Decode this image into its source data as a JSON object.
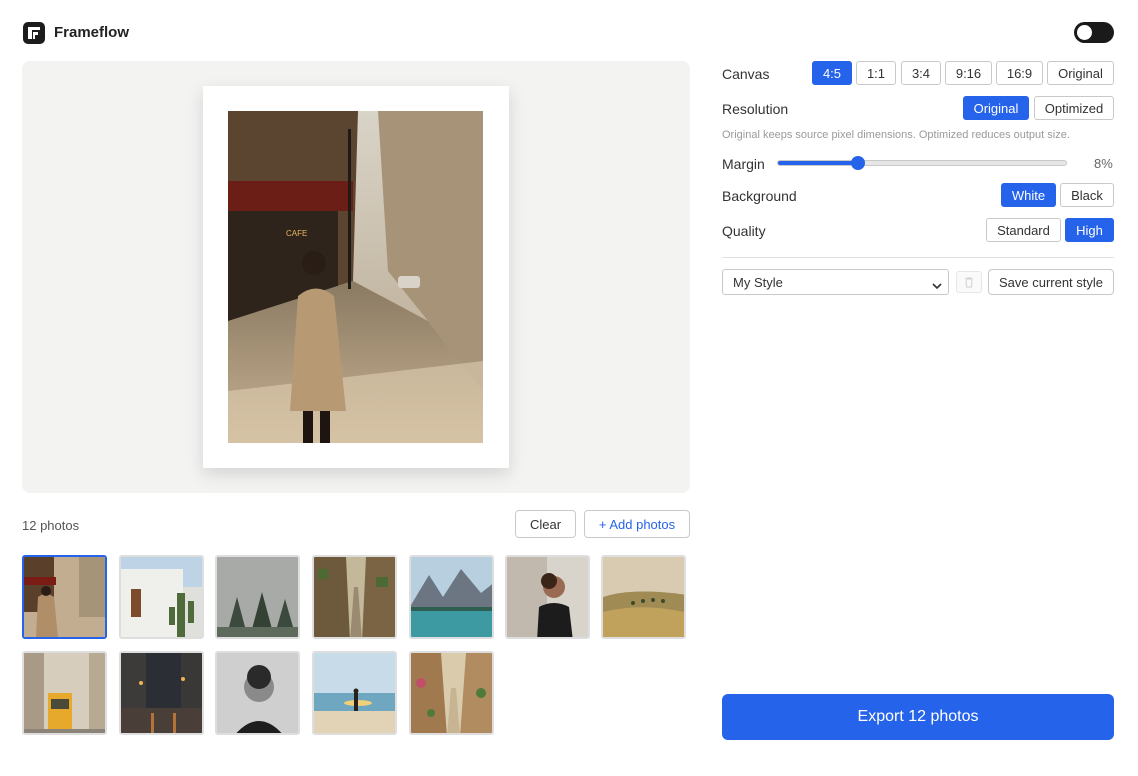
{
  "app": {
    "title": "Frameflow",
    "logo_icon": "frame-logo-icon"
  },
  "header": {
    "theme_toggle_icon": "toggle-icon"
  },
  "photos": {
    "count_label": "12 photos",
    "clear_label": "Clear",
    "add_label": "+ Add photos",
    "thumbnails": [
      {
        "subject": "paris street cafe woman in trench coat",
        "selected": true
      },
      {
        "subject": "white wall with cactus"
      },
      {
        "subject": "foggy pine forest"
      },
      {
        "subject": "narrow old town alley"
      },
      {
        "subject": "mountain lake"
      },
      {
        "subject": "woman portrait profile"
      },
      {
        "subject": "tuscany rolling hills"
      },
      {
        "subject": "yellow tram on city street"
      },
      {
        "subject": "rainy city street at dusk"
      },
      {
        "subject": "black and white man portrait"
      },
      {
        "subject": "surfer on beach"
      },
      {
        "subject": "flowered narrow lane"
      }
    ]
  },
  "settings": {
    "canvas": {
      "label": "Canvas",
      "options": [
        "4:5",
        "1:1",
        "3:4",
        "9:16",
        "16:9",
        "Original"
      ],
      "selected": "4:5"
    },
    "resolution": {
      "label": "Resolution",
      "options": [
        "Original",
        "Optimized"
      ],
      "selected": "Original",
      "hint": "Original keeps source pixel dimensions. Optimized reduces output size."
    },
    "margin": {
      "label": "Margin",
      "value": 8,
      "value_label": "8%",
      "fraction": 0.27
    },
    "background": {
      "label": "Background",
      "options": [
        "White",
        "Black"
      ],
      "selected": "White"
    },
    "quality": {
      "label": "Quality",
      "options": [
        "Standard",
        "High"
      ],
      "selected": "High"
    },
    "style": {
      "selected": "My Style",
      "save_label": "Save current style",
      "delete_icon": "trash-icon"
    }
  },
  "export": {
    "label": "Export 12 photos"
  },
  "colors": {
    "accent": "#2563eb",
    "toggle": "#1a1a1a",
    "preview_bg": "#f3f3f2"
  }
}
